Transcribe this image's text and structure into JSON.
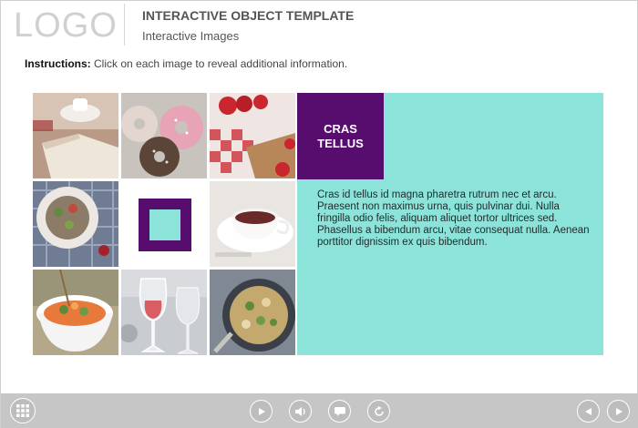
{
  "header": {
    "logo": "LOGO",
    "title": "INTERACTIVE OBJECT TEMPLATE",
    "subtitle": "Interactive Images"
  },
  "instructions": {
    "label": "Instructions:",
    "text": " Click on each image to reveal additional information."
  },
  "grid": {
    "tiles": [
      {
        "name": "image-book-coffee",
        "icon": "book-coffee-photo"
      },
      {
        "name": "image-donuts",
        "icon": "donuts-photo"
      },
      {
        "name": "image-strawberries",
        "icon": "strawberries-photo"
      },
      {
        "name": "image-salad-plate",
        "icon": "salad-plate-photo"
      },
      {
        "name": "image-selected-placeholder",
        "icon": "selected-square-icon"
      },
      {
        "name": "image-tea-cup",
        "icon": "tea-cup-photo"
      },
      {
        "name": "image-noodle-bowl",
        "icon": "noodle-bowl-photo"
      },
      {
        "name": "image-wine-glass",
        "icon": "wine-glass-photo"
      },
      {
        "name": "image-frying-pan",
        "icon": "frying-pan-photo"
      }
    ]
  },
  "panel": {
    "heading": "CRAS TELLUS",
    "body": "Cras id tellus id magna pharetra rutrum nec et arcu. Praesent non maximus urna, quis pulvinar dui. Nulla fringilla odio felis, aliquam aliquet tortor ultrices sed. Phasellus a bibendum arcu, vitae consequat nulla. Aenean porttitor dignissim ex quis bibendum."
  },
  "colors": {
    "accent_purple": "#560d6e",
    "accent_mint": "#8ce3da",
    "toolbar": "#c6c6c6"
  },
  "toolbar": {
    "icons": [
      "menu-grid-icon",
      "play-icon",
      "volume-icon",
      "captions-icon",
      "replay-icon",
      "prev-icon",
      "next-icon"
    ]
  }
}
